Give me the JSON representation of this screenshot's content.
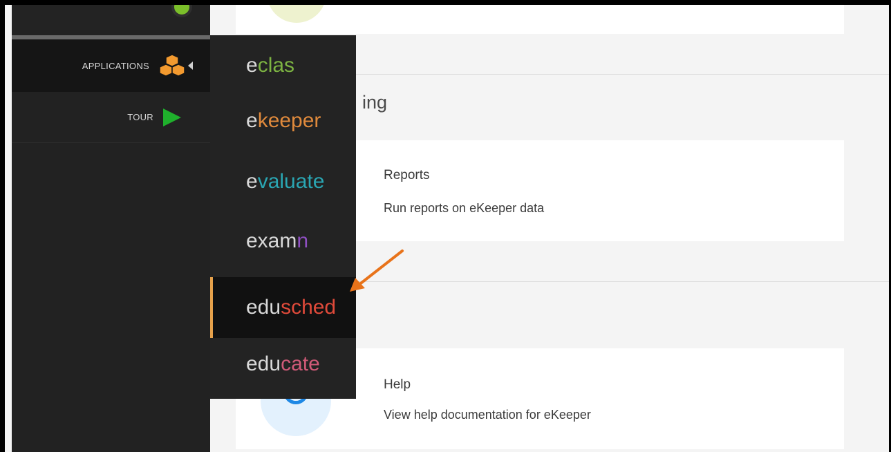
{
  "sidebar": {
    "items": [
      {
        "label": "APPLICATIONS",
        "icon": "cubes-icon",
        "icon_color": "#f39a2f"
      },
      {
        "label": "TOUR",
        "icon": "play-icon",
        "icon_color": "#1fb02c"
      }
    ]
  },
  "dropdown": {
    "items": [
      {
        "prefix": "e",
        "suffix": "clas",
        "suffix_color": "#7cb342"
      },
      {
        "prefix": "e",
        "suffix": "keeper",
        "suffix_color": "#e08a3c"
      },
      {
        "prefix": "e",
        "suffix": "valuate",
        "suffix_color": "#2aa6b3"
      },
      {
        "prefix": "exam",
        "suffix": "n",
        "suffix_color": "#8e4fc1"
      },
      {
        "prefix": "edu",
        "suffix": "sched",
        "suffix_color": "#e04a3a",
        "active": true
      },
      {
        "prefix": "edu",
        "suffix": "cate",
        "suffix_color": "#d05a78"
      }
    ],
    "active_border_color": "#e6a14b"
  },
  "main": {
    "section_heading": "ing",
    "cards": [
      {
        "title": "Reports",
        "description": "Run reports on eKeeper data"
      },
      {
        "title": "Help",
        "description": "View help documentation for eKeeper",
        "icon": "help-icon"
      }
    ]
  },
  "annotation": {
    "arrow_color": "#e8731a"
  }
}
